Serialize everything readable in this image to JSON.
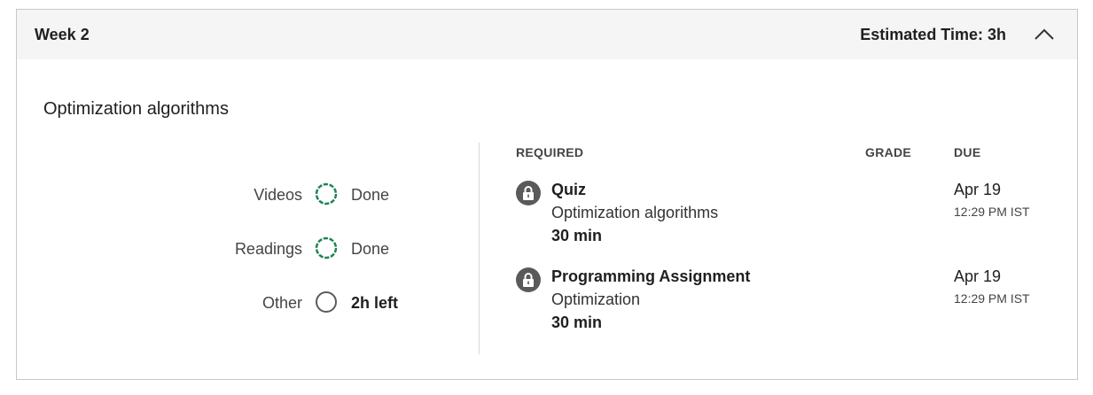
{
  "header": {
    "week_title": "Week 2",
    "estimated_time": "Estimated Time: 3h",
    "collapse_icon": "chevron-up-icon"
  },
  "module": {
    "title": "Optimization algorithms"
  },
  "progress": [
    {
      "label": "Videos",
      "status": "Done",
      "state": "done",
      "color": "#1f8354"
    },
    {
      "label": "Readings",
      "status": "Done",
      "state": "done",
      "color": "#1f8354"
    },
    {
      "label": "Other",
      "status": "2h left",
      "state": "pending",
      "color": "#5a5a5a"
    }
  ],
  "columns": {
    "required": "REQUIRED",
    "grade": "GRADE",
    "due": "DUE"
  },
  "items": [
    {
      "icon": "lock-icon",
      "type": "Quiz",
      "name": "Optimization algorithms",
      "duration": "30 min",
      "due_date": "Apr 19",
      "due_time": "12:29 PM IST"
    },
    {
      "icon": "lock-icon",
      "type": "Programming Assignment",
      "name": "Optimization",
      "duration": "30 min",
      "due_date": "Apr 19",
      "due_time": "12:29 PM IST"
    }
  ]
}
